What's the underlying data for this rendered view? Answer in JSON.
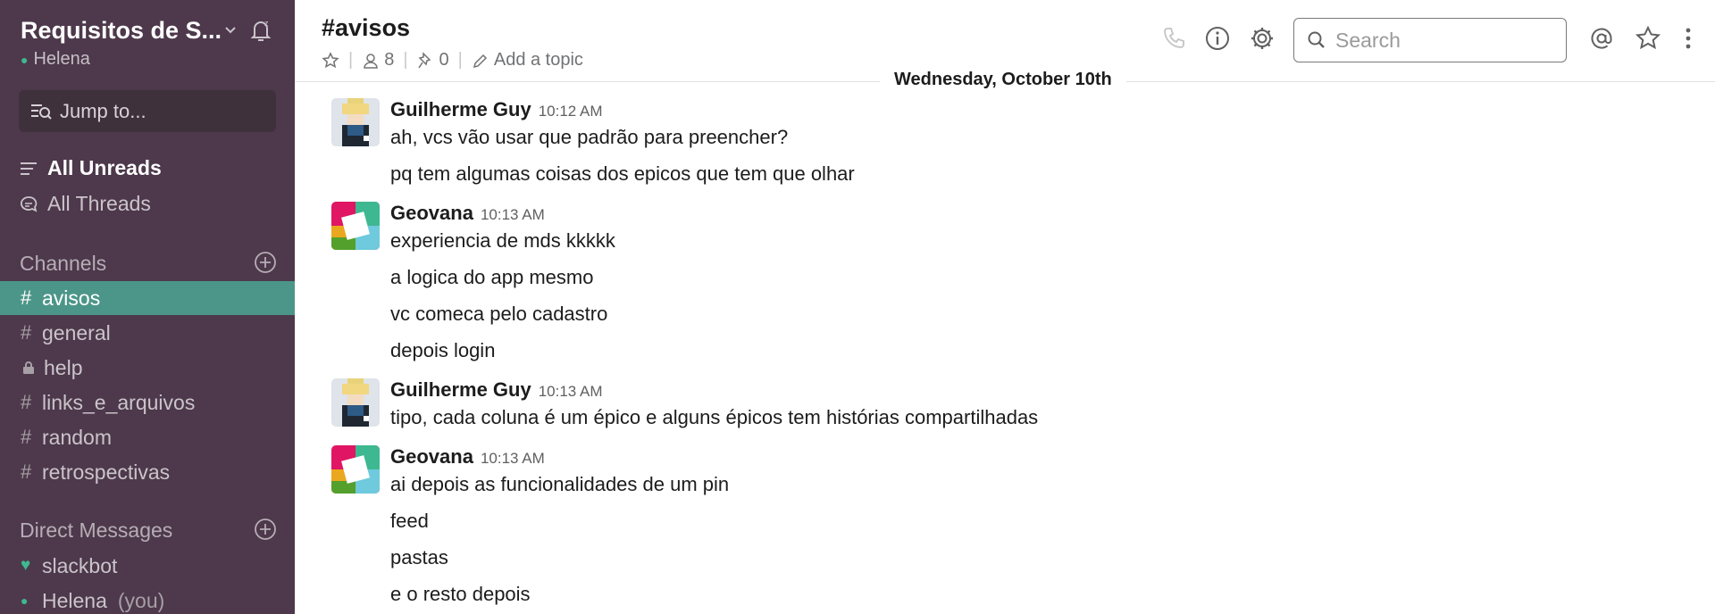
{
  "workspace": {
    "name": "Requisitos de S...",
    "user": "Helena"
  },
  "sidebar": {
    "jump_placeholder": "Jump to...",
    "all_unreads": "All Unreads",
    "all_threads": "All Threads",
    "channels_header": "Channels",
    "channels": [
      {
        "name": "avisos",
        "active": true,
        "private": false
      },
      {
        "name": "general",
        "private": false
      },
      {
        "name": "help",
        "private": true
      },
      {
        "name": "links_e_arquivos",
        "private": false
      },
      {
        "name": "random",
        "private": false
      },
      {
        "name": "retrospectivas",
        "private": false
      }
    ],
    "dm_header": "Direct Messages",
    "dms": [
      {
        "name": "slackbot",
        "suffix": ""
      },
      {
        "name": "Helena",
        "suffix": "(you)"
      }
    ]
  },
  "header": {
    "channel": "#avisos",
    "members": "8",
    "pins": "0",
    "topic": "Add a topic",
    "search_placeholder": "Search"
  },
  "date_divider": "Wednesday, October 10th",
  "messages": [
    {
      "author": "Guilherme Guy",
      "time": "10:12 AM",
      "avatar": "pixel",
      "lines": [
        "ah, vcs vão usar que padrão para preencher?",
        "pq tem algumas coisas dos epicos que tem que olhar"
      ]
    },
    {
      "author": "Geovana",
      "time": "10:13 AM",
      "avatar": "slack",
      "lines": [
        "experiencia de mds kkkkk",
        "a logica do app mesmo",
        "vc comeca pelo cadastro",
        "depois login"
      ]
    },
    {
      "author": "Guilherme Guy",
      "time": "10:13 AM",
      "avatar": "pixel",
      "lines": [
        "tipo, cada coluna é um épico e alguns épicos tem histórias compartilhadas"
      ]
    },
    {
      "author": "Geovana",
      "time": "10:13 AM",
      "avatar": "slack",
      "lines": [
        "ai depois as funcionalidades de um pin",
        "feed",
        "pastas",
        "e o resto depois"
      ]
    }
  ],
  "colors": {
    "sidebar_bg": "#4d394b",
    "active_channel": "#4c9689",
    "presence": "#3eb890"
  }
}
